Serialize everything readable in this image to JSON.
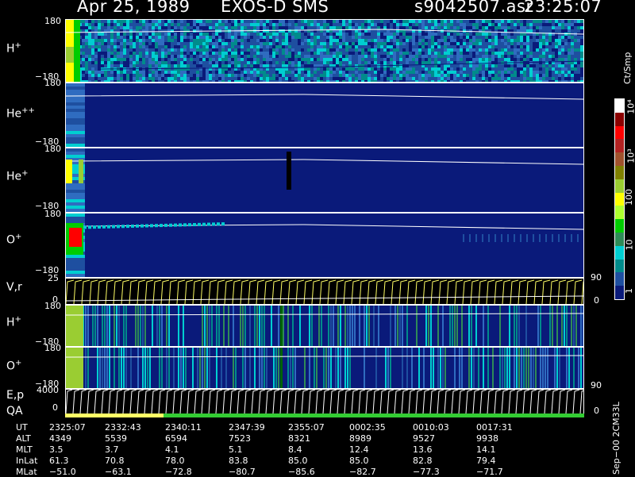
{
  "header": {
    "date": "Apr 25, 1989",
    "instrument": "EXOS-D SMS",
    "file": "s9042507.asr",
    "time": "23:25:07"
  },
  "colorbar": {
    "unit": "Ct/Smp",
    "ticks": [
      "10⁴",
      "10³",
      "100",
      "10",
      "1"
    ],
    "colors": [
      "#ffffff",
      "#8b0000",
      "#ff0000",
      "#b22222",
      "#a0522d",
      "#808000",
      "#9acd32",
      "#ffff00",
      "#adff2f",
      "#00cc00",
      "#2e8b57",
      "#00ced1",
      "#008b8b",
      "#1e4fa0",
      "#0a1a7a"
    ]
  },
  "panels": [
    {
      "id": "h-plus",
      "label": "H",
      "sup": "+",
      "top_tick": "180",
      "bottom_tick": "−180"
    },
    {
      "id": "he-plus-plus",
      "label": "He",
      "sup": "++",
      "top_tick": "180",
      "bottom_tick": "−180"
    },
    {
      "id": "he-plus",
      "label": "He",
      "sup": "+",
      "top_tick": "180",
      "bottom_tick": "−180"
    },
    {
      "id": "o-plus",
      "label": "O",
      "sup": "+",
      "top_tick": "180",
      "bottom_tick": "−180"
    },
    {
      "id": "vr",
      "label": "V,r",
      "sup": "",
      "top_tick": "25",
      "bottom_tick": "0",
      "right_top": "90",
      "right_bottom": "0"
    },
    {
      "id": "h-plus-2",
      "label": "H",
      "sup": "+",
      "top_tick": "180",
      "bottom_tick": "−180"
    },
    {
      "id": "o-plus-2",
      "label": "O",
      "sup": "+",
      "top_tick": "180",
      "bottom_tick": "−180"
    },
    {
      "id": "ep",
      "label": "E,p",
      "sup": "",
      "top_tick": "4000",
      "bottom_tick": "0",
      "right_top": "90",
      "right_bottom": "0"
    }
  ],
  "qa_label": "QA",
  "ephemeris": {
    "rows": [
      {
        "label": "UT",
        "values": [
          "2325:07",
          "2332:43",
          "2340:11",
          "2347:39",
          "2355:07",
          "0002:35",
          "0010:03",
          "0017:31"
        ]
      },
      {
        "label": "ALT",
        "values": [
          "4349",
          "5539",
          "6594",
          "7523",
          "8321",
          "8989",
          "9527",
          "9938"
        ]
      },
      {
        "label": "MLT",
        "values": [
          "3.5",
          "3.7",
          "4.1",
          "5.1",
          "8.4",
          "12.4",
          "13.6",
          "14.1"
        ]
      },
      {
        "label": "InLat",
        "values": [
          "61.3",
          "70.8",
          "78.0",
          "83.8",
          "85.0",
          "85.0",
          "82.8",
          "79.4"
        ]
      },
      {
        "label": "MLat",
        "values": [
          "−51.0",
          "−63.1",
          "−72.8",
          "−80.7",
          "−85.6",
          "−82.7",
          "−77.3",
          "−71.7"
        ]
      }
    ]
  },
  "footer_id": "Sep−00  2CM33L",
  "chart_data": {
    "type": "heatmap",
    "title": "Apr 25, 1989   EXOS-D SMS",
    "x_ticks": [
      "2325:07",
      "2332:43",
      "2340:11",
      "2347:39",
      "2355:07",
      "0002:35",
      "0010:03",
      "0017:31"
    ],
    "panels": [
      {
        "name": "H+",
        "ylim": [
          -180,
          180
        ]
      },
      {
        "name": "He++",
        "ylim": [
          -180,
          180
        ]
      },
      {
        "name": "He+",
        "ylim": [
          -180,
          180
        ]
      },
      {
        "name": "O+",
        "ylim": [
          -180,
          180
        ]
      },
      {
        "name": "V,r",
        "ylim": [
          0,
          25
        ],
        "y2lim": [
          0,
          90
        ]
      },
      {
        "name": "H+",
        "ylim": [
          -180,
          180
        ]
      },
      {
        "name": "O+",
        "ylim": [
          -180,
          180
        ]
      },
      {
        "name": "E,p",
        "ylim": [
          0,
          4000
        ],
        "y2lim": [
          0,
          90
        ]
      }
    ],
    "colorbar_label": "Ct/Smp",
    "colorbar_ticks": [
      "1",
      "10",
      "100",
      "10³",
      "10⁴"
    ]
  }
}
